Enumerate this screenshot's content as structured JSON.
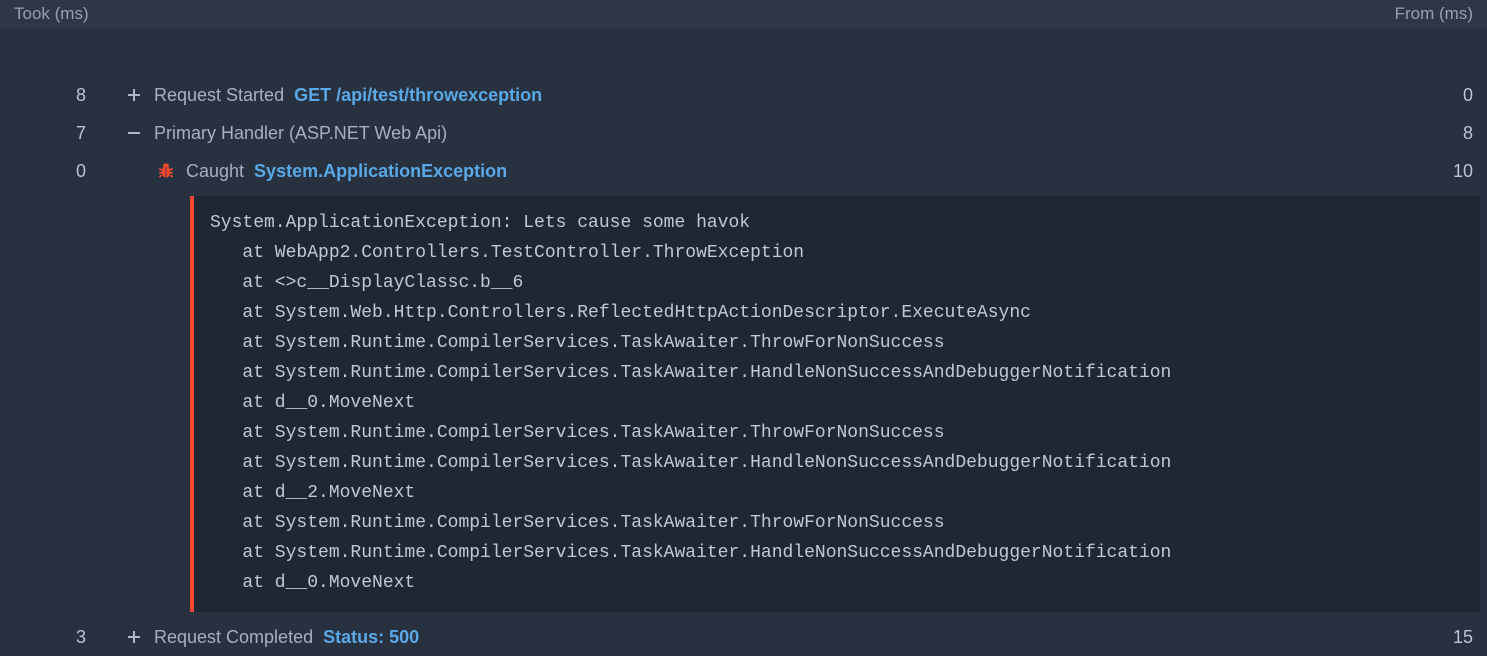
{
  "header": {
    "took_label": "Took (ms)",
    "from_label": "From (ms)"
  },
  "rows": {
    "request_started": {
      "took": "8",
      "from": "0",
      "label": "Request Started",
      "detail": "GET /api/test/throwexception"
    },
    "primary_handler": {
      "took": "7",
      "from": "8",
      "label": "Primary Handler (ASP.NET Web Api)"
    },
    "caught": {
      "took": "0",
      "from": "10",
      "label": "Caught",
      "exception": "System.ApplicationException"
    },
    "request_completed": {
      "took": "3",
      "from": "15",
      "label": "Request Completed",
      "status": "Status: 500"
    }
  },
  "stack_trace": "System.ApplicationException: Lets cause some havok\n   at WebApp2.Controllers.TestController.ThrowException\n   at <>c__DisplayClassc.b__6\n   at System.Web.Http.Controllers.ReflectedHttpActionDescriptor.ExecuteAsync\n   at System.Runtime.CompilerServices.TaskAwaiter.ThrowForNonSuccess\n   at System.Runtime.CompilerServices.TaskAwaiter.HandleNonSuccessAndDebuggerNotification\n   at d__0.MoveNext\n   at System.Runtime.CompilerServices.TaskAwaiter.ThrowForNonSuccess\n   at System.Runtime.CompilerServices.TaskAwaiter.HandleNonSuccessAndDebuggerNotification\n   at d__2.MoveNext\n   at System.Runtime.CompilerServices.TaskAwaiter.ThrowForNonSuccess\n   at System.Runtime.CompilerServices.TaskAwaiter.HandleNonSuccessAndDebuggerNotification\n   at d__0.MoveNext"
}
